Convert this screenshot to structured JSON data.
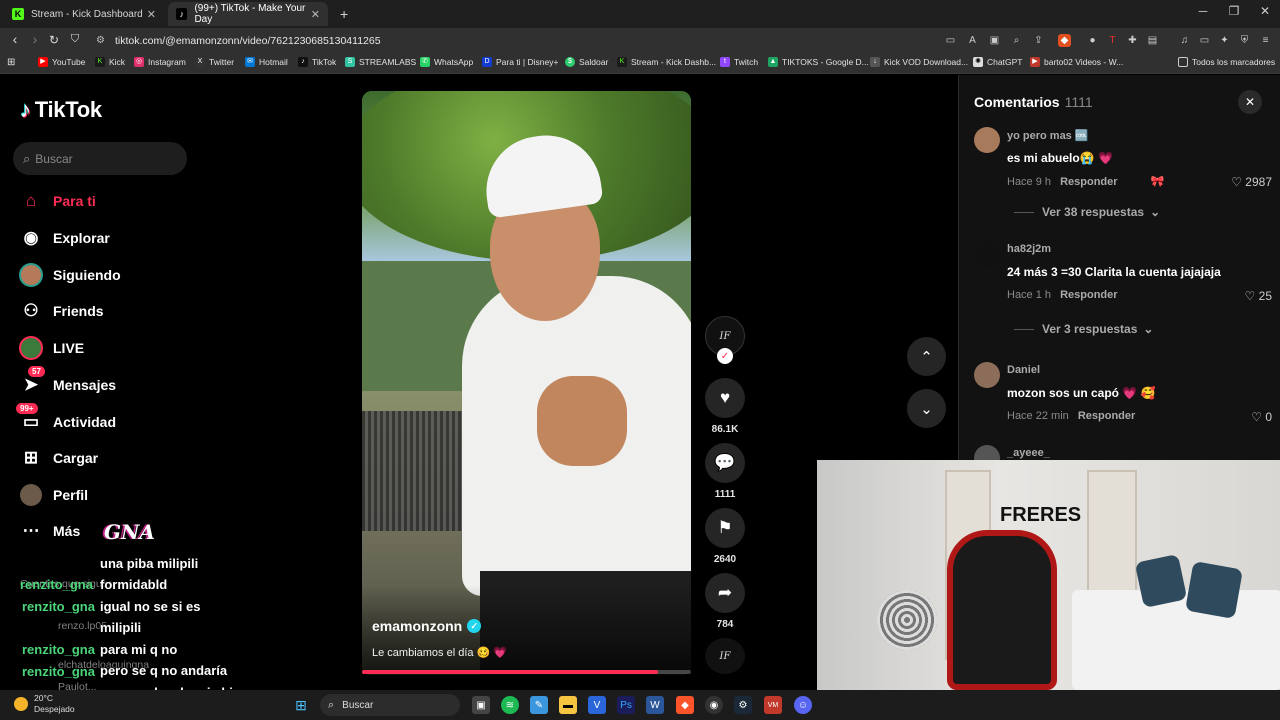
{
  "browser": {
    "tabs": [
      {
        "label": "Stream - Kick Dashboard",
        "icon": "kick-icon"
      },
      {
        "label": "(99+) TikTok - Make Your Day",
        "icon": "tiktok-icon",
        "active": true
      }
    ],
    "new_tab": "+",
    "url": "tiktok.com/@emamonzonn/video/7621230685130411265",
    "bookmarks": [
      {
        "label": "YouTube",
        "color": "#ff0000"
      },
      {
        "label": "Kick",
        "color": "#53fc18"
      },
      {
        "label": "Instagram",
        "color": "#e1306c"
      },
      {
        "label": "Twitter",
        "color": "#333333"
      },
      {
        "label": "Hotmail",
        "color": "#0078d4"
      },
      {
        "label": "TikTok",
        "color": "#111111"
      },
      {
        "label": "STREAMLABS",
        "color": "#31c3a2"
      },
      {
        "label": "WhatsApp",
        "color": "#25d366"
      },
      {
        "label": "Para ti | Disney+",
        "color": "#113ccf"
      },
      {
        "label": "Saldoar",
        "color": "#2ecc71"
      },
      {
        "label": "Stream - Kick Dashb...",
        "color": "#53fc18"
      },
      {
        "label": "Twitch",
        "color": "#9146ff"
      },
      {
        "label": "TIKTOKS - Google D...",
        "color": "#1fa463"
      },
      {
        "label": "Kick VOD Download...",
        "color": "#555555"
      },
      {
        "label": "ChatGPT",
        "color": "#dddddd"
      },
      {
        "label": "barto02 Videos - W...",
        "color": "#c0392b"
      }
    ],
    "all_bookmarks": "Todos los marcadores"
  },
  "sidebar": {
    "logo": "TikTok",
    "search_placeholder": "Buscar",
    "items": [
      {
        "label": "Para ti",
        "icon": "home-icon"
      },
      {
        "label": "Explorar",
        "icon": "compass-icon"
      },
      {
        "label": "Siguiendo",
        "icon": "following-avatar-icon"
      },
      {
        "label": "Friends",
        "icon": "friends-icon"
      },
      {
        "label": "LIVE",
        "icon": "live-icon"
      },
      {
        "label": "Mensajes",
        "icon": "messages-icon",
        "badge": "57"
      },
      {
        "label": "Actividad",
        "icon": "activity-icon",
        "badge": "99+"
      },
      {
        "label": "Cargar",
        "icon": "upload-icon"
      },
      {
        "label": "Perfil",
        "icon": "profile-avatar-icon"
      },
      {
        "label": "Más",
        "icon": "more-icon"
      }
    ]
  },
  "video": {
    "author": "emamonzonn",
    "caption": "Le cambiamos el día 🥴 💗",
    "progress": 0.9
  },
  "actions": {
    "likes": "86.1K",
    "comments": "1111",
    "saves": "2640",
    "shares": "784"
  },
  "comments_panel": {
    "title": "Comentarios",
    "count": "1111",
    "comments": [
      {
        "user": "yo pero mas 🆒",
        "text": "es mi abuelo😭 💗",
        "time": "Hace 9 h",
        "reply": "Responder",
        "likes": "2987",
        "replies": "Ver 38 respuestas"
      },
      {
        "user": "ha82j2m",
        "text": "24 más 3 =30 Clarita la cuenta jajajaja",
        "time": "Hace 1 h",
        "reply": "Responder",
        "likes": "25",
        "replies": "Ver 3 respuestas"
      },
      {
        "user": "Daniel",
        "text": "mozon sos un capó 💗 🥰",
        "time": "Hace 22 min",
        "reply": "Responder",
        "likes": "0"
      },
      {
        "user": "_ayeee_"
      }
    ]
  },
  "overlay": {
    "webcam_sign": "FRERES",
    "brand": "GNA",
    "chat": {
      "ghost_lines": [
        "Cuentas que sigues",
        "renzo.lp05",
        "elchatdeloaguingna",
        "Paulot..."
      ],
      "usernames": [
        "renzito_gna",
        "renzito_gna",
        "renzito_gna",
        "renzito_gna"
      ],
      "messages": [
        "una piba milipili",
        "formidabld",
        "igual no se si es",
        "milipili",
        "para mi q no",
        "pero se q no andaría",
        "con un plancha ni ahi"
      ]
    }
  },
  "taskbar": {
    "temperature": "20°C",
    "condition": "Despejado",
    "search": "Buscar"
  }
}
